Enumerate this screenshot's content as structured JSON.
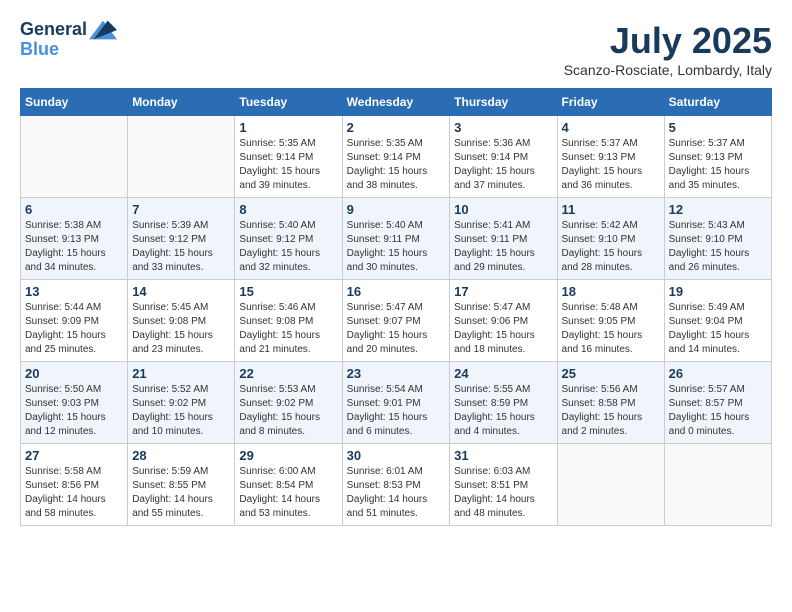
{
  "header": {
    "logo_line1": "General",
    "logo_line2": "Blue",
    "month": "July 2025",
    "location": "Scanzo-Rosciate, Lombardy, Italy"
  },
  "weekdays": [
    "Sunday",
    "Monday",
    "Tuesday",
    "Wednesday",
    "Thursday",
    "Friday",
    "Saturday"
  ],
  "weeks": [
    [
      {
        "day": "",
        "sunrise": "",
        "sunset": "",
        "daylight": ""
      },
      {
        "day": "",
        "sunrise": "",
        "sunset": "",
        "daylight": ""
      },
      {
        "day": "1",
        "sunrise": "Sunrise: 5:35 AM",
        "sunset": "Sunset: 9:14 PM",
        "daylight": "Daylight: 15 hours and 39 minutes."
      },
      {
        "day": "2",
        "sunrise": "Sunrise: 5:35 AM",
        "sunset": "Sunset: 9:14 PM",
        "daylight": "Daylight: 15 hours and 38 minutes."
      },
      {
        "day": "3",
        "sunrise": "Sunrise: 5:36 AM",
        "sunset": "Sunset: 9:14 PM",
        "daylight": "Daylight: 15 hours and 37 minutes."
      },
      {
        "day": "4",
        "sunrise": "Sunrise: 5:37 AM",
        "sunset": "Sunset: 9:13 PM",
        "daylight": "Daylight: 15 hours and 36 minutes."
      },
      {
        "day": "5",
        "sunrise": "Sunrise: 5:37 AM",
        "sunset": "Sunset: 9:13 PM",
        "daylight": "Daylight: 15 hours and 35 minutes."
      }
    ],
    [
      {
        "day": "6",
        "sunrise": "Sunrise: 5:38 AM",
        "sunset": "Sunset: 9:13 PM",
        "daylight": "Daylight: 15 hours and 34 minutes."
      },
      {
        "day": "7",
        "sunrise": "Sunrise: 5:39 AM",
        "sunset": "Sunset: 9:12 PM",
        "daylight": "Daylight: 15 hours and 33 minutes."
      },
      {
        "day": "8",
        "sunrise": "Sunrise: 5:40 AM",
        "sunset": "Sunset: 9:12 PM",
        "daylight": "Daylight: 15 hours and 32 minutes."
      },
      {
        "day": "9",
        "sunrise": "Sunrise: 5:40 AM",
        "sunset": "Sunset: 9:11 PM",
        "daylight": "Daylight: 15 hours and 30 minutes."
      },
      {
        "day": "10",
        "sunrise": "Sunrise: 5:41 AM",
        "sunset": "Sunset: 9:11 PM",
        "daylight": "Daylight: 15 hours and 29 minutes."
      },
      {
        "day": "11",
        "sunrise": "Sunrise: 5:42 AM",
        "sunset": "Sunset: 9:10 PM",
        "daylight": "Daylight: 15 hours and 28 minutes."
      },
      {
        "day": "12",
        "sunrise": "Sunrise: 5:43 AM",
        "sunset": "Sunset: 9:10 PM",
        "daylight": "Daylight: 15 hours and 26 minutes."
      }
    ],
    [
      {
        "day": "13",
        "sunrise": "Sunrise: 5:44 AM",
        "sunset": "Sunset: 9:09 PM",
        "daylight": "Daylight: 15 hours and 25 minutes."
      },
      {
        "day": "14",
        "sunrise": "Sunrise: 5:45 AM",
        "sunset": "Sunset: 9:08 PM",
        "daylight": "Daylight: 15 hours and 23 minutes."
      },
      {
        "day": "15",
        "sunrise": "Sunrise: 5:46 AM",
        "sunset": "Sunset: 9:08 PM",
        "daylight": "Daylight: 15 hours and 21 minutes."
      },
      {
        "day": "16",
        "sunrise": "Sunrise: 5:47 AM",
        "sunset": "Sunset: 9:07 PM",
        "daylight": "Daylight: 15 hours and 20 minutes."
      },
      {
        "day": "17",
        "sunrise": "Sunrise: 5:47 AM",
        "sunset": "Sunset: 9:06 PM",
        "daylight": "Daylight: 15 hours and 18 minutes."
      },
      {
        "day": "18",
        "sunrise": "Sunrise: 5:48 AM",
        "sunset": "Sunset: 9:05 PM",
        "daylight": "Daylight: 15 hours and 16 minutes."
      },
      {
        "day": "19",
        "sunrise": "Sunrise: 5:49 AM",
        "sunset": "Sunset: 9:04 PM",
        "daylight": "Daylight: 15 hours and 14 minutes."
      }
    ],
    [
      {
        "day": "20",
        "sunrise": "Sunrise: 5:50 AM",
        "sunset": "Sunset: 9:03 PM",
        "daylight": "Daylight: 15 hours and 12 minutes."
      },
      {
        "day": "21",
        "sunrise": "Sunrise: 5:52 AM",
        "sunset": "Sunset: 9:02 PM",
        "daylight": "Daylight: 15 hours and 10 minutes."
      },
      {
        "day": "22",
        "sunrise": "Sunrise: 5:53 AM",
        "sunset": "Sunset: 9:02 PM",
        "daylight": "Daylight: 15 hours and 8 minutes."
      },
      {
        "day": "23",
        "sunrise": "Sunrise: 5:54 AM",
        "sunset": "Sunset: 9:01 PM",
        "daylight": "Daylight: 15 hours and 6 minutes."
      },
      {
        "day": "24",
        "sunrise": "Sunrise: 5:55 AM",
        "sunset": "Sunset: 8:59 PM",
        "daylight": "Daylight: 15 hours and 4 minutes."
      },
      {
        "day": "25",
        "sunrise": "Sunrise: 5:56 AM",
        "sunset": "Sunset: 8:58 PM",
        "daylight": "Daylight: 15 hours and 2 minutes."
      },
      {
        "day": "26",
        "sunrise": "Sunrise: 5:57 AM",
        "sunset": "Sunset: 8:57 PM",
        "daylight": "Daylight: 15 hours and 0 minutes."
      }
    ],
    [
      {
        "day": "27",
        "sunrise": "Sunrise: 5:58 AM",
        "sunset": "Sunset: 8:56 PM",
        "daylight": "Daylight: 14 hours and 58 minutes."
      },
      {
        "day": "28",
        "sunrise": "Sunrise: 5:59 AM",
        "sunset": "Sunset: 8:55 PM",
        "daylight": "Daylight: 14 hours and 55 minutes."
      },
      {
        "day": "29",
        "sunrise": "Sunrise: 6:00 AM",
        "sunset": "Sunset: 8:54 PM",
        "daylight": "Daylight: 14 hours and 53 minutes."
      },
      {
        "day": "30",
        "sunrise": "Sunrise: 6:01 AM",
        "sunset": "Sunset: 8:53 PM",
        "daylight": "Daylight: 14 hours and 51 minutes."
      },
      {
        "day": "31",
        "sunrise": "Sunrise: 6:03 AM",
        "sunset": "Sunset: 8:51 PM",
        "daylight": "Daylight: 14 hours and 48 minutes."
      },
      {
        "day": "",
        "sunrise": "",
        "sunset": "",
        "daylight": ""
      },
      {
        "day": "",
        "sunrise": "",
        "sunset": "",
        "daylight": ""
      }
    ]
  ]
}
